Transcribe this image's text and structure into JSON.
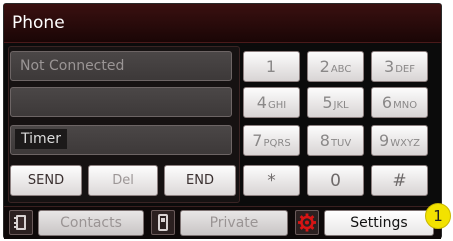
{
  "title": "Phone",
  "fields": {
    "connection_status": "Not Connected",
    "number_display": "",
    "timer_label": "Timer"
  },
  "controls": {
    "send": "SEND",
    "del": "Del",
    "end": "END"
  },
  "keypad": [
    {
      "digit": "1",
      "letters": ""
    },
    {
      "digit": "2",
      "letters": "ABC"
    },
    {
      "digit": "3",
      "letters": "DEF"
    },
    {
      "digit": "4",
      "letters": "GHI"
    },
    {
      "digit": "5",
      "letters": "JKL"
    },
    {
      "digit": "6",
      "letters": "MNO"
    },
    {
      "digit": "7",
      "letters": "PQRS"
    },
    {
      "digit": "8",
      "letters": "TUV"
    },
    {
      "digit": "9",
      "letters": "WXYZ"
    },
    {
      "digit": "*",
      "letters": ""
    },
    {
      "digit": "0",
      "letters": ""
    },
    {
      "digit": "#",
      "letters": ""
    }
  ],
  "bottom_bar": {
    "contacts": "Contacts",
    "private": "Private",
    "settings": "Settings"
  },
  "callout_number": "1",
  "icons": {
    "contacts": "phonebook-icon",
    "private": "handset-icon",
    "settings": "gear-icon"
  },
  "colors": {
    "accent": "#c80a0a",
    "callout": "#f2e200"
  }
}
